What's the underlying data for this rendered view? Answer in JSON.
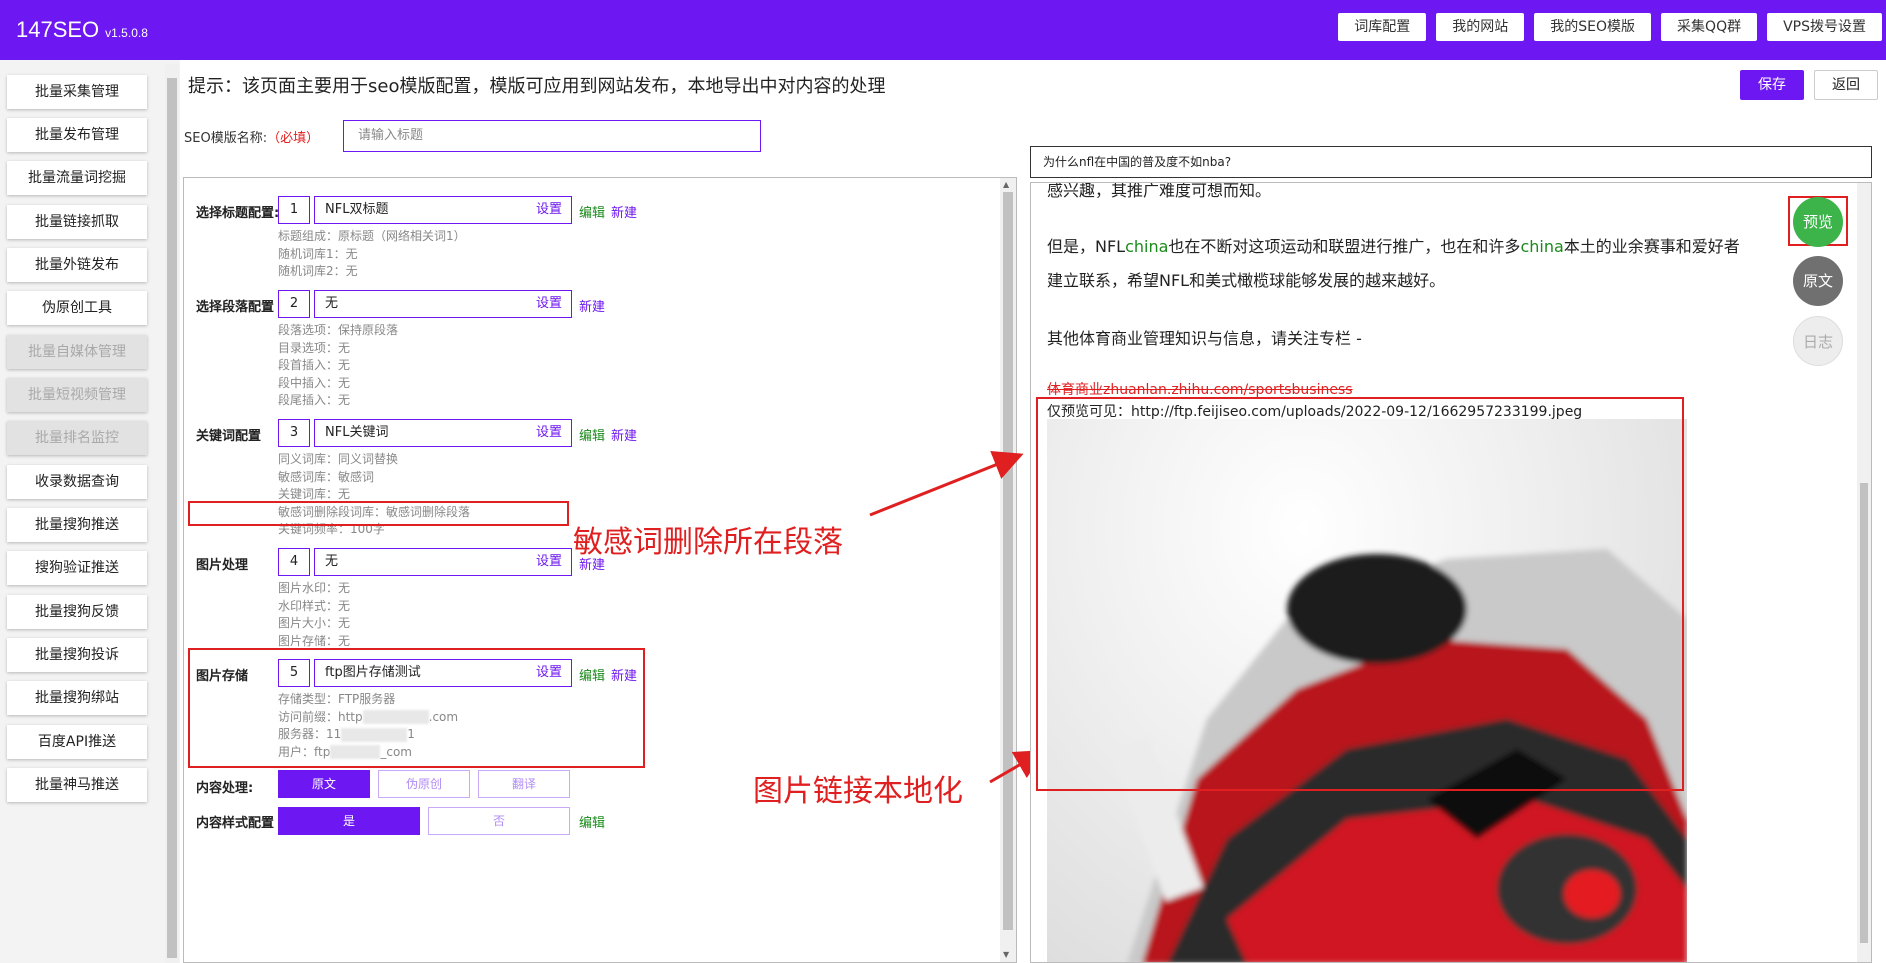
{
  "app": {
    "name": "147SEO",
    "version": "v1.5.0.8"
  },
  "topnav": [
    "词库配置",
    "我的网站",
    "我的SEO模版",
    "采集QQ群",
    "VPS拨号设置"
  ],
  "sidebar": [
    {
      "label": "批量采集管理",
      "disabled": false
    },
    {
      "label": "批量发布管理",
      "disabled": false
    },
    {
      "label": "批量流量词挖掘",
      "disabled": false
    },
    {
      "label": "批量链接抓取",
      "disabled": false
    },
    {
      "label": "批量外链发布",
      "disabled": false
    },
    {
      "label": "伪原创工具",
      "disabled": false
    },
    {
      "label": "批量自媒体管理",
      "disabled": true
    },
    {
      "label": "批量短视频管理",
      "disabled": true
    },
    {
      "label": "批量排名监控",
      "disabled": true
    },
    {
      "label": "收录数据查询",
      "disabled": false
    },
    {
      "label": "批量搜狗推送",
      "disabled": false
    },
    {
      "label": "搜狗验证推送",
      "disabled": false
    },
    {
      "label": "批量搜狗反馈",
      "disabled": false
    },
    {
      "label": "批量搜狗投诉",
      "disabled": false
    },
    {
      "label": "批量搜狗绑站",
      "disabled": false
    },
    {
      "label": "百度API推送",
      "disabled": false
    },
    {
      "label": "批量神马推送",
      "disabled": false
    }
  ],
  "header": {
    "tip": "提示：该页面主要用于seo模版配置，模版可应用到网站发布，本地导出中对内容的处理",
    "save": "保存",
    "back": "返回"
  },
  "template_name": {
    "label": "SEO模版名称:",
    "required": "（必填）",
    "placeholder": "请输入标题"
  },
  "common": {
    "set": "设置",
    "edit": "编辑",
    "new": "新建"
  },
  "config": {
    "title": {
      "label": "选择标题配置:",
      "num": "1",
      "value": "NFL双标题",
      "info": [
        "标题组成：原标题（网络相关词1）",
        "随机词库1：无",
        "随机词库2：无"
      ]
    },
    "paragraph": {
      "label": "选择段落配置",
      "num": "2",
      "value": "无",
      "info": [
        "段落选项：保持原段落",
        "目录选项：无",
        "段首插入：无",
        "段中插入：无",
        "段尾插入：无"
      ]
    },
    "keyword": {
      "label": "关键词配置",
      "num": "3",
      "value": "NFL关键词",
      "info": [
        "同义词库：同义词替换",
        "敏感词库：敏感词",
        "关键词库：无",
        "敏感词删除段词库：敏感词删除段落",
        "关键词频率：100字"
      ]
    },
    "image_proc": {
      "label": "图片处理",
      "num": "4",
      "value": "无",
      "info": [
        "图片水印：无",
        "水印样式：无",
        "图片大小：无",
        "图片存储：无"
      ]
    },
    "image_store": {
      "label": "图片存储",
      "num": "5",
      "value": "ftp图片存储测试",
      "info": {
        "type": "存储类型：FTP服务器",
        "prefix_a": "访问前缀：http",
        "prefix_b": ".com",
        "server_a": "服务器：11",
        "server_b": "1",
        "user_a": "用户：ftp",
        "user_b": "_com"
      }
    },
    "content_proc": {
      "label": "内容处理:",
      "options": [
        "原文",
        "伪原创",
        "翻译"
      ],
      "selected": "原文"
    },
    "content_style": {
      "label": "内容样式配置",
      "options": [
        "是",
        "否"
      ],
      "selected": "是"
    }
  },
  "annotations": {
    "sensitive": "敏感词删除所在段落",
    "image_local": "图片链接本地化"
  },
  "preview": {
    "title": "为什么nfl在中国的普及度不如nba?",
    "line0": "感兴趣，其推广难度可想而知。",
    "line1_a": "但是，NFL",
    "line1_hl1": "china",
    "line1_b": "也在不断对这项运动和联盟进行推广，也在和许多",
    "line1_hl2": "china",
    "line1_c": "本土的业余赛事和爱好者",
    "line2": "建立联系，希望NFL和美式橄榄球能够发展的越来越好。",
    "line3": "其他体育商业管理知识与信息，请关注专栏 -",
    "link": "体育商业zhuanlan.zhihu.com/sportsbusiness",
    "image_url": "仅预览可见：http://ftp.feijiseo.com/uploads/2022-09-12/1662957233199.jpeg",
    "side_buttons": [
      "预览",
      "原文",
      "日志"
    ]
  }
}
